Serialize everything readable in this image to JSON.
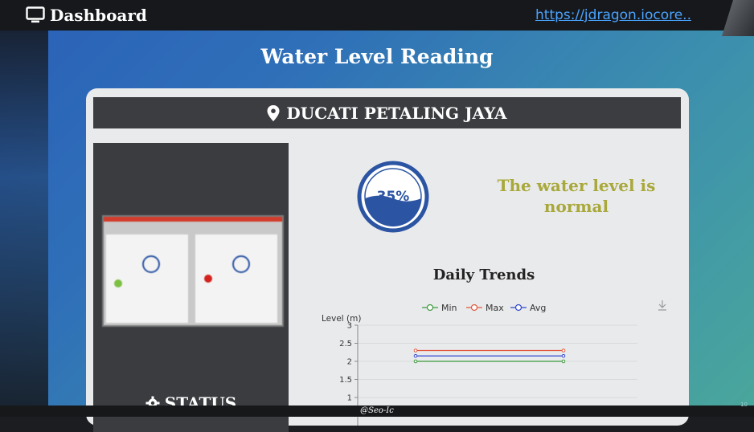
{
  "header": {
    "app_title": "Dashboard",
    "url": "https://jdragon.iocore.."
  },
  "page": {
    "title": "Water Level Reading"
  },
  "location": {
    "name": "DUCATI PETALING JAYA"
  },
  "side_panel": {
    "status_label": "STATUS"
  },
  "gauge": {
    "percent_label": "35%",
    "fill_fraction": 0.35,
    "color": "#2b54a3"
  },
  "status_message": "The water level is normal",
  "chart_data": {
    "type": "line",
    "title": "Daily Trends",
    "ylabel": "Level (m)",
    "ylim": [
      0.5,
      3
    ],
    "y_ticks": [
      "3",
      "2.5",
      "2",
      "1.5",
      "1"
    ],
    "legend_position": "top",
    "series": [
      {
        "name": "Min",
        "color": "#3b9a3b",
        "values": [
          2.0,
          2.0
        ]
      },
      {
        "name": "Max",
        "color": "#e2573d",
        "values": [
          2.3,
          2.3
        ]
      },
      {
        "name": "Avg",
        "color": "#2f46d0",
        "values": [
          2.15,
          2.15
        ]
      }
    ]
  },
  "footer": {
    "credit": "@Seo-Ic",
    "page_number": "10"
  }
}
